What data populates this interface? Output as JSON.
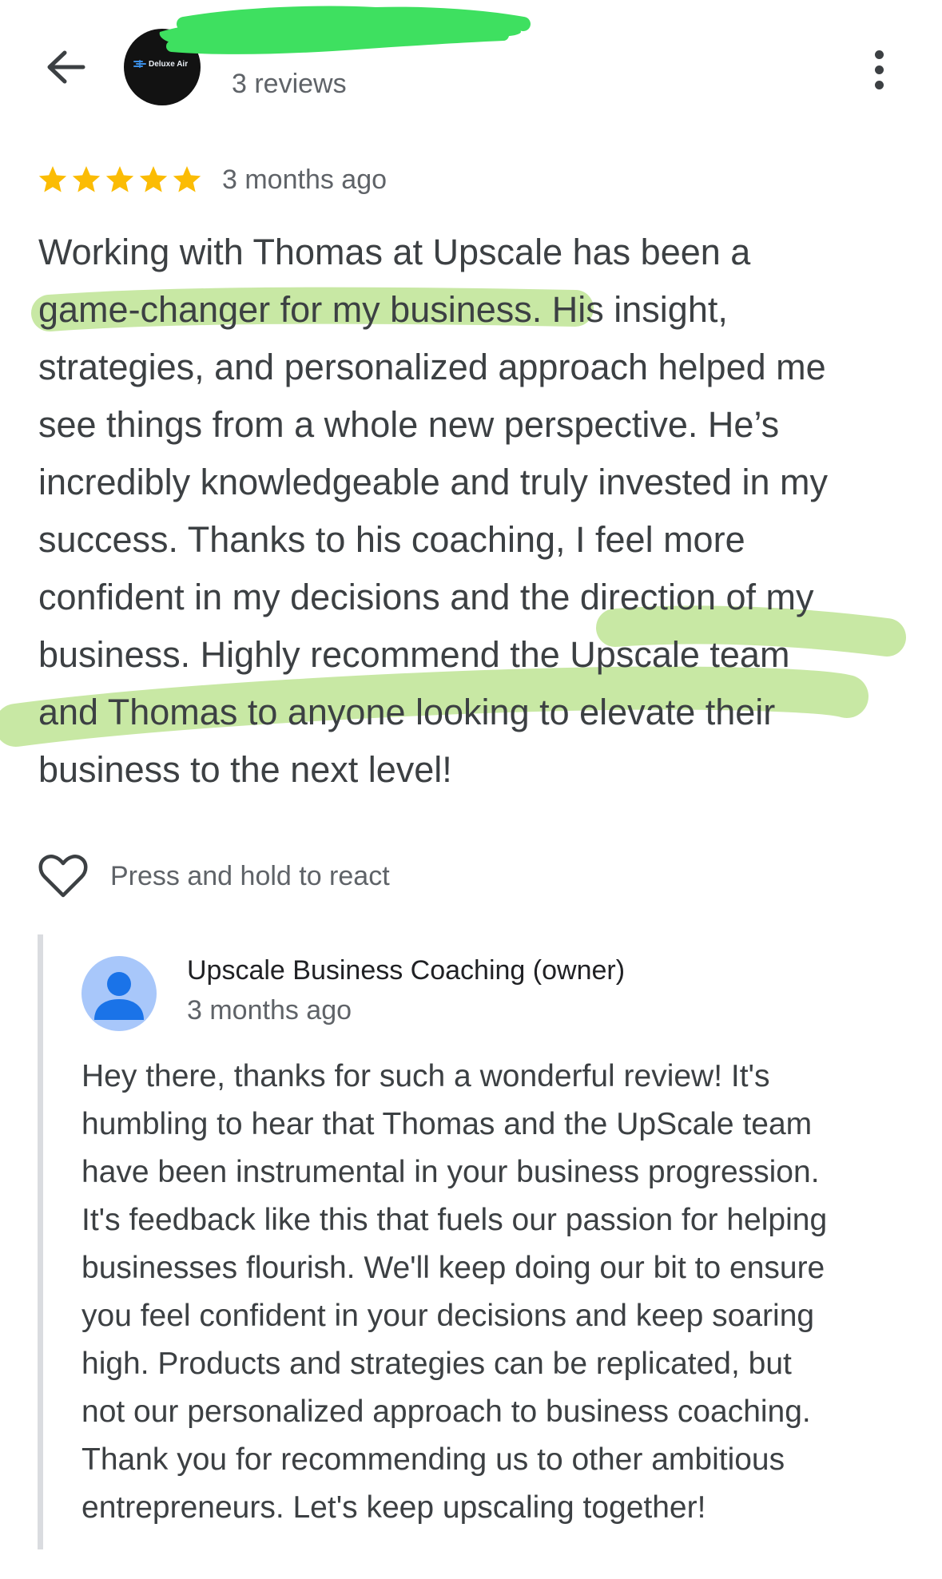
{
  "header": {
    "back_icon": "arrow-back-icon",
    "avatar_logo_text": "Deluxe Air",
    "reviewer_name": "",
    "reviews_count": "3 reviews",
    "more_icon": "more-vert-icon"
  },
  "review": {
    "rating": 5,
    "rating_max": 5,
    "star_color": "#fbbc04",
    "date": "3 months ago",
    "lines": [
      "Working with Thomas at Upscale has been a",
      "game-changer for my business. His insight,",
      "strategies, and personalized approach helped me",
      "see things from a whole new perspective. He’s",
      "incredibly knowledgeable and truly invested in my",
      "success. Thanks to his coaching, I feel more",
      "confident in my decisions and the direction of my",
      "business. Highly recommend the Upscale team",
      "and Thomas to anyone looking to elevate their",
      "business to the next level!"
    ],
    "highlight_color": "#9bd65a"
  },
  "react": {
    "heart_icon": "heart-outline-icon",
    "label": "Press and hold to react"
  },
  "owner_reply": {
    "avatar_icon": "person-icon",
    "avatar_color": "#1a73e8",
    "name": "Upscale Business Coaching (owner)",
    "date": "3 months ago",
    "lines": [
      "Hey there, thanks for such a wonderful review! It's",
      "humbling to hear that Thomas and the UpScale team",
      "have been instrumental in your business progression.",
      "It's feedback like this that fuels our passion for helping",
      "businesses flourish. We'll keep doing our bit to ensure",
      "you feel confident in your decisions and keep soaring",
      "high. Products and strategies can be replicated, but",
      "not our personalized approach to business coaching.",
      "Thank you for recommending us to other ambitious",
      "entrepreneurs. Let's keep upscaling together!"
    ]
  }
}
